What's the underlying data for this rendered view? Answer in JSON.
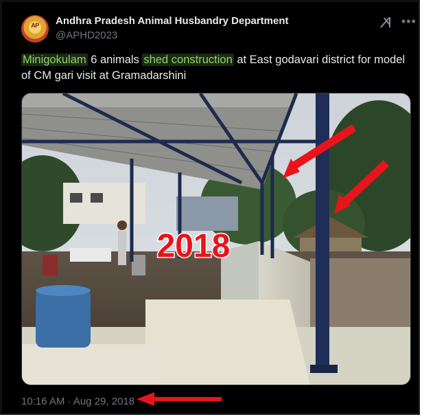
{
  "author": {
    "name": "Andhra Pradesh Animal Husbandry Department",
    "handle": "@APHD2023",
    "avatar_icon": "department-logo-icon"
  },
  "tweet": {
    "text_parts": [
      {
        "text": "Minigokulam",
        "highlight": true
      },
      {
        "text": " 6 animals ",
        "highlight": false
      },
      {
        "text": "shed construction",
        "highlight": true
      },
      {
        "text": " at East godavari district for model of CM gari visit at Gramadarshini",
        "highlight": false
      }
    ]
  },
  "media": {
    "overlay_year": "2018"
  },
  "timestamp": "10:16 AM · Aug 29, 2018",
  "colors": {
    "background": "#000000",
    "text": "#e7e9ea",
    "muted": "#71767b",
    "highlight_text": "#93d36b",
    "arrow": "#e8141b",
    "overlay_text": "#e8141b"
  }
}
